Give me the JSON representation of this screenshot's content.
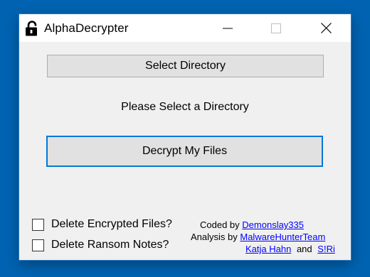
{
  "window": {
    "title": "AlphaDecrypter",
    "icon": "unlocked-padlock-icon",
    "controls": [
      "minimize-icon",
      "maximize-icon",
      "close-icon"
    ]
  },
  "buttons": {
    "select_directory": "Select Directory",
    "decrypt": "Decrypt My Files"
  },
  "status_text": "Please Select a Directory",
  "options": {
    "delete_encrypted": {
      "label": "Delete Encrypted Files?",
      "checked": false
    },
    "delete_notes": {
      "label": "Delete Ransom Notes?",
      "checked": false
    }
  },
  "credits": {
    "coded_by_label": "Coded by",
    "coder": "Demonslay335",
    "analysis_by_label": "Analysis by",
    "analyst1": "MalwareHunterTeam",
    "analyst2": "Katja Hahn",
    "and_label": "and",
    "analyst3": "S!Ri"
  },
  "colors": {
    "desktop": "#0063b1",
    "window_bg": "#f0f0f0",
    "button_bg": "#e1e1e1",
    "focus_border": "#0078d7",
    "link": "#0000ff"
  }
}
